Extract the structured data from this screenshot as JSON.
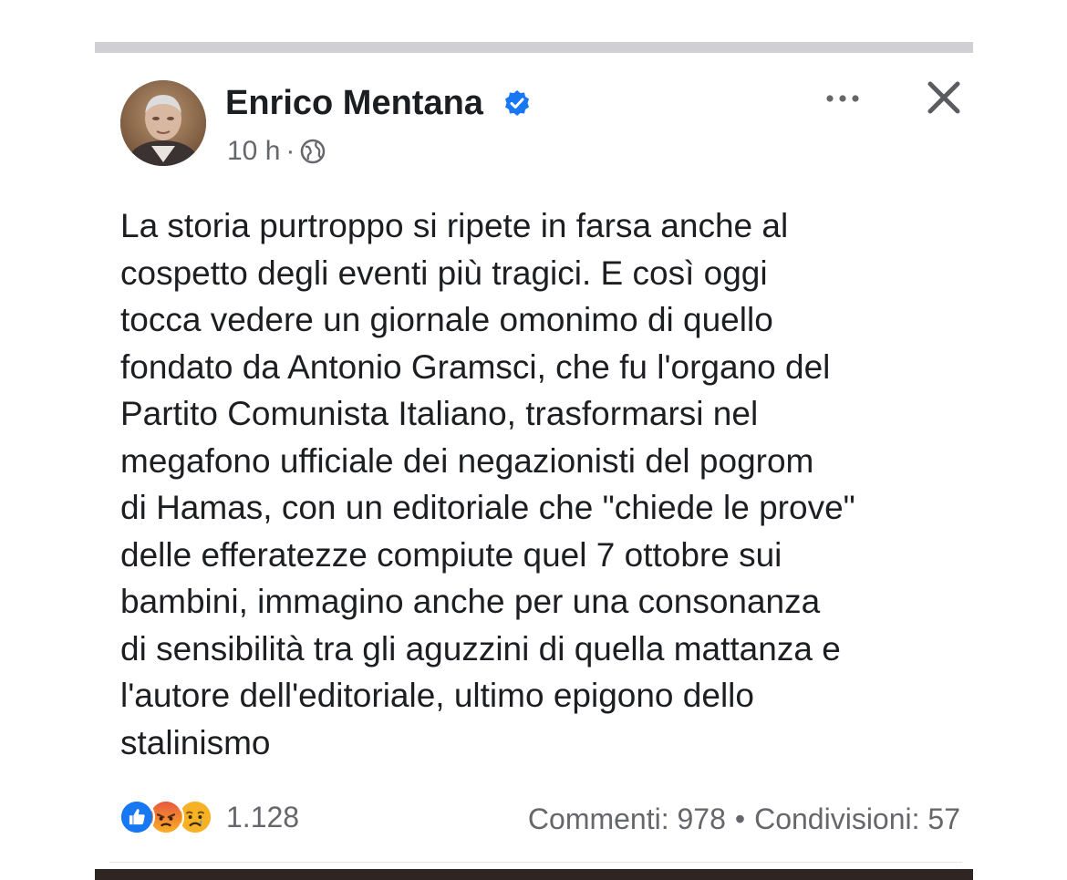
{
  "post": {
    "author": "Enrico Mentana",
    "verified": true,
    "time": "10 h",
    "separator": "·",
    "audience_icon": "globe-icon",
    "text_lines": [
      "La storia purtroppo si ripete in farsa anche al",
      "cospetto degli eventi più tragici. E così oggi",
      "tocca vedere un giornale omonimo di quello",
      "fondato da Antonio Gramsci, che fu l'organo del",
      "Partito Comunista Italiano, trasformarsi nel",
      "megafono ufficiale dei negazionisti del pogrom",
      "di Hamas, con un editoriale che \"chiede le prove\"",
      "delle efferatezze compiute quel 7 ottobre sui",
      "bambini, immagino anche per una consonanza",
      "di sensibilità tra gli aguzzini di quella mattanza e",
      "l'autore dell'editoriale, ultimo epigono dello",
      "stalinismo"
    ]
  },
  "reactions": {
    "icons": [
      "like-icon",
      "angry-icon",
      "sad-icon"
    ],
    "count": "1.128"
  },
  "engagement": {
    "comments": "Commenti: 978",
    "bullet": "•",
    "shares": "Condivisioni: 57"
  },
  "colors": {
    "verified_blue": "#1877f2",
    "secondary_text": "#65676b",
    "primary_text": "#1c1e21",
    "like_blue": "#1877f2",
    "angry_red": "#e9573f",
    "sad_yellow": "#f7b125"
  }
}
